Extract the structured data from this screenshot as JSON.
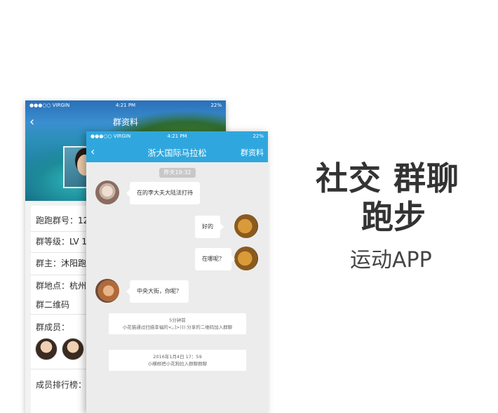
{
  "back_screen": {
    "status": {
      "carrier": "●●●○○ VIRGIN",
      "time": "4:21 PM",
      "battery": "22%"
    },
    "title": "群资料",
    "rows": [
      {
        "label": "跑跑群号：",
        "value": "12"
      },
      {
        "label": "群等级：",
        "value": "LV 1"
      },
      {
        "label": "群主：",
        "value": "沐阳跑"
      },
      {
        "label": "群地点：",
        "value": "杭州"
      },
      {
        "label": "群二维码",
        "value": ""
      },
      {
        "label": "群成员：",
        "value": ""
      }
    ],
    "ranking_label": "成员排行榜："
  },
  "chat_screen": {
    "status": {
      "carrier": "●●●○○ VIRGIN",
      "time": "4:21 PM",
      "battery": "22%"
    },
    "title": "浙大国际马拉松",
    "menu_label": "群资料",
    "time_divider": "昨天19:32",
    "messages": [
      {
        "side": "left",
        "avatar": "girl-avatar",
        "text": "在的李大夫大陆法打待"
      },
      {
        "side": "right",
        "avatar": "dog-avatar",
        "text": "好的"
      },
      {
        "side": "right",
        "avatar": "dog-avatar",
        "text": "在哪呢？"
      },
      {
        "side": "left",
        "avatar": "cat-avatar",
        "text": "中央大街，你呢？"
      }
    ],
    "system_notices": [
      {
        "line1": "5分钟前",
        "line2": "小花猫通过扫描幸福的<。]>))):分享的二维码加入群聊"
      },
      {
        "line1": "2016年1月4日 17：59",
        "line2": "小横样把小花狗拉入群聊群聊"
      }
    ]
  },
  "promo": {
    "headline_line1": "社交 群聊",
    "headline_line2": "跑步",
    "subtitle": "运动APP"
  }
}
